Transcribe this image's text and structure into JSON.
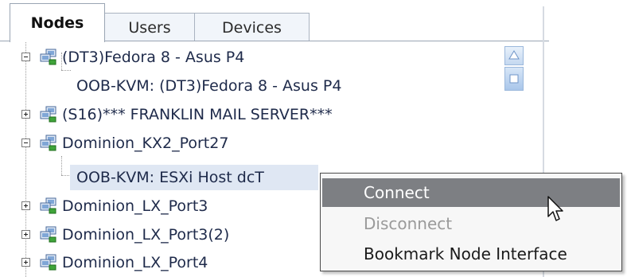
{
  "tabs": [
    {
      "label": "Nodes",
      "active": true
    },
    {
      "label": "Users",
      "active": false
    },
    {
      "label": "Devices",
      "active": false
    }
  ],
  "tree": {
    "rows": [
      {
        "label": "(DT3)Fedora 8 - Asus P4",
        "expanded": true,
        "icon": "network-node-icon"
      },
      {
        "label": "OOB-KVM: (DT3)Fedora 8 - Asus P4",
        "child": true
      },
      {
        "label": "(S16)*** FRANKLIN MAIL SERVER***",
        "expanded": false,
        "icon": "network-node-icon"
      },
      {
        "label": "Dominion_KX2_Port27",
        "expanded": true,
        "icon": "network-node-icon"
      },
      {
        "label": "OOB-KVM: ESXi Host dcT",
        "child": true,
        "selected": true
      },
      {
        "label": "Dominion_LX_Port3",
        "expanded": false,
        "icon": "network-node-icon"
      },
      {
        "label": "Dominion_LX_Port3(2)",
        "expanded": false,
        "icon": "network-node-icon"
      },
      {
        "label": "Dominion_LX_Port4",
        "expanded": false,
        "icon": "network-node-icon"
      }
    ]
  },
  "context_menu": {
    "items": [
      {
        "label": "Connect",
        "state": "hover"
      },
      {
        "label": "Disconnect",
        "state": "disabled"
      },
      {
        "label": "Bookmark Node Interface",
        "state": "normal"
      }
    ]
  },
  "colors": {
    "accent_hover": "#7d7f83",
    "selection": "#dfe7f3",
    "text": "#1e2a4a"
  }
}
